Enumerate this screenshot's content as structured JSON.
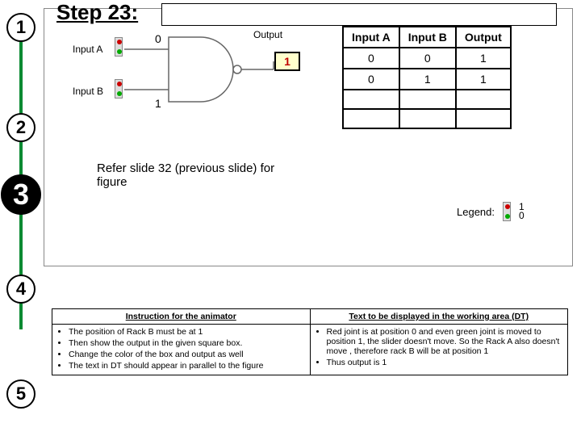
{
  "title": "Step 23:",
  "steps": {
    "s1": "1",
    "s2": "2",
    "s3": "3",
    "s4": "4",
    "s5": "5"
  },
  "circuit": {
    "inputA_label": "Input A",
    "inputB_label": "Input B",
    "output_label": "Output",
    "inputA_value": "0",
    "inputB_value": "1",
    "output_value": "1"
  },
  "truth": {
    "headers": {
      "a": "Input A",
      "b": "Input B",
      "out": "Output"
    },
    "rows": [
      {
        "a": "0",
        "b": "0",
        "out": "1"
      },
      {
        "a": "0",
        "b": "1",
        "out": "1"
      },
      {
        "a": "",
        "b": "",
        "out": ""
      },
      {
        "a": "",
        "b": "",
        "out": ""
      }
    ]
  },
  "refer_note": "Refer slide 32 (previous slide) for figure",
  "legend": {
    "label": "Legend:",
    "v1": "1",
    "v0": "0"
  },
  "instr": {
    "left_header": "Instruction for the animator",
    "right_header": "Text to be displayed in the working area (DT)",
    "left": [
      "The position of Rack B must be at 1",
      "Then show the output in the given square box.",
      "Change the color of the box and output as well",
      "The text in DT should appear in parallel to the figure"
    ],
    "right": [
      "Red joint is at position 0 and even green joint is moved to position 1, the slider doesn't move. So the Rack A also doesn't move , therefore rack B will be at position 1",
      "Thus output is 1"
    ]
  },
  "chart_data": {
    "type": "table",
    "title": "NAND truth table (partial, step 23)",
    "columns": [
      "Input A",
      "Input B",
      "Output"
    ],
    "rows": [
      [
        0,
        0,
        1
      ],
      [
        0,
        1,
        1
      ]
    ]
  }
}
